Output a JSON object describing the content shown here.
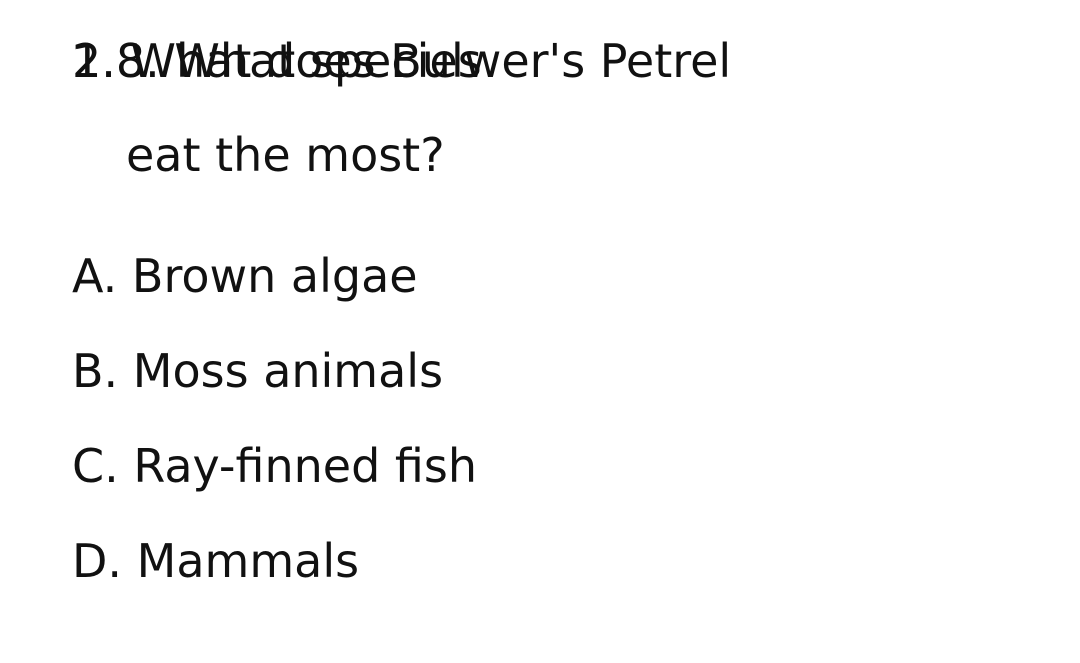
{
  "question": {
    "overlap_text_a": "2. What does Bulwer's Petrel",
    "overlap_text_b": "1.8. What species",
    "continuation": "eat the most?"
  },
  "options": [
    "A. Brown algae",
    "B. Moss animals",
    "C. Ray-finned fish",
    "D. Mammals"
  ]
}
